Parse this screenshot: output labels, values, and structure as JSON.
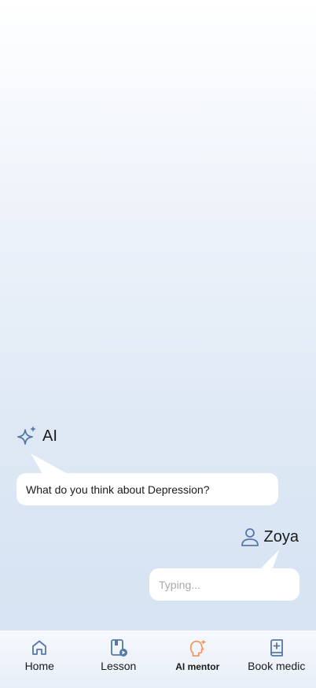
{
  "chat": {
    "ai": {
      "name": "AI",
      "icon": "sparkle-icon",
      "message": "What do you think about Depression?"
    },
    "user": {
      "name": "Zoya",
      "icon": "user-icon",
      "input_placeholder": "Typing..."
    }
  },
  "nav": {
    "items": [
      {
        "label": "Home",
        "icon": "home-icon"
      },
      {
        "label": "Lesson",
        "icon": "lesson-icon"
      },
      {
        "label": "AI mentor",
        "icon": "ai-mentor-icon",
        "active": true
      },
      {
        "label": "Book medic",
        "icon": "book-medic-icon"
      }
    ]
  },
  "colors": {
    "icon": "#5478a8",
    "active": "#f0955a",
    "bubble": "#ffffff",
    "text": "#1a1a1a",
    "placeholder": "#a8a8a8"
  }
}
